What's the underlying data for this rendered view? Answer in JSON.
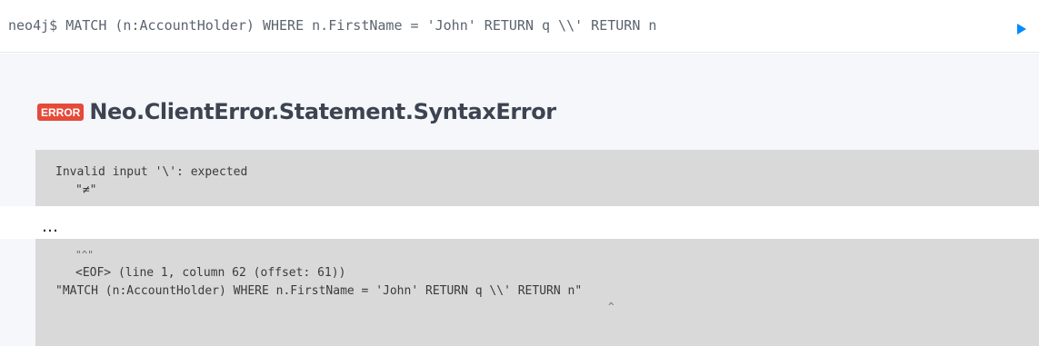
{
  "editor": {
    "command": "neo4j$ MATCH (n:AccountHolder) WHERE n.FirstName = 'John' RETURN q \\\\' RETURN n",
    "run_icon": "play-icon"
  },
  "error": {
    "badge": "ERROR",
    "title": "Neo.ClientError.Statement.SyntaxError"
  },
  "message_top": {
    "line1": "Invalid input '\\': expected",
    "line2": "\"≠\""
  },
  "truncation": "…",
  "message_bottom": {
    "line1": "\"^\"",
    "line2": "<EOF> (line 1, column 62 (offset: 61))",
    "line3": "\"MATCH (n:AccountHolder) WHERE n.FirstName = 'John' RETURN q \\\\' RETURN n\"",
    "line4": "^"
  },
  "colors": {
    "accent": "#018bff",
    "error_badge": "#e54a3a",
    "code_bg": "#d9d9d9"
  }
}
